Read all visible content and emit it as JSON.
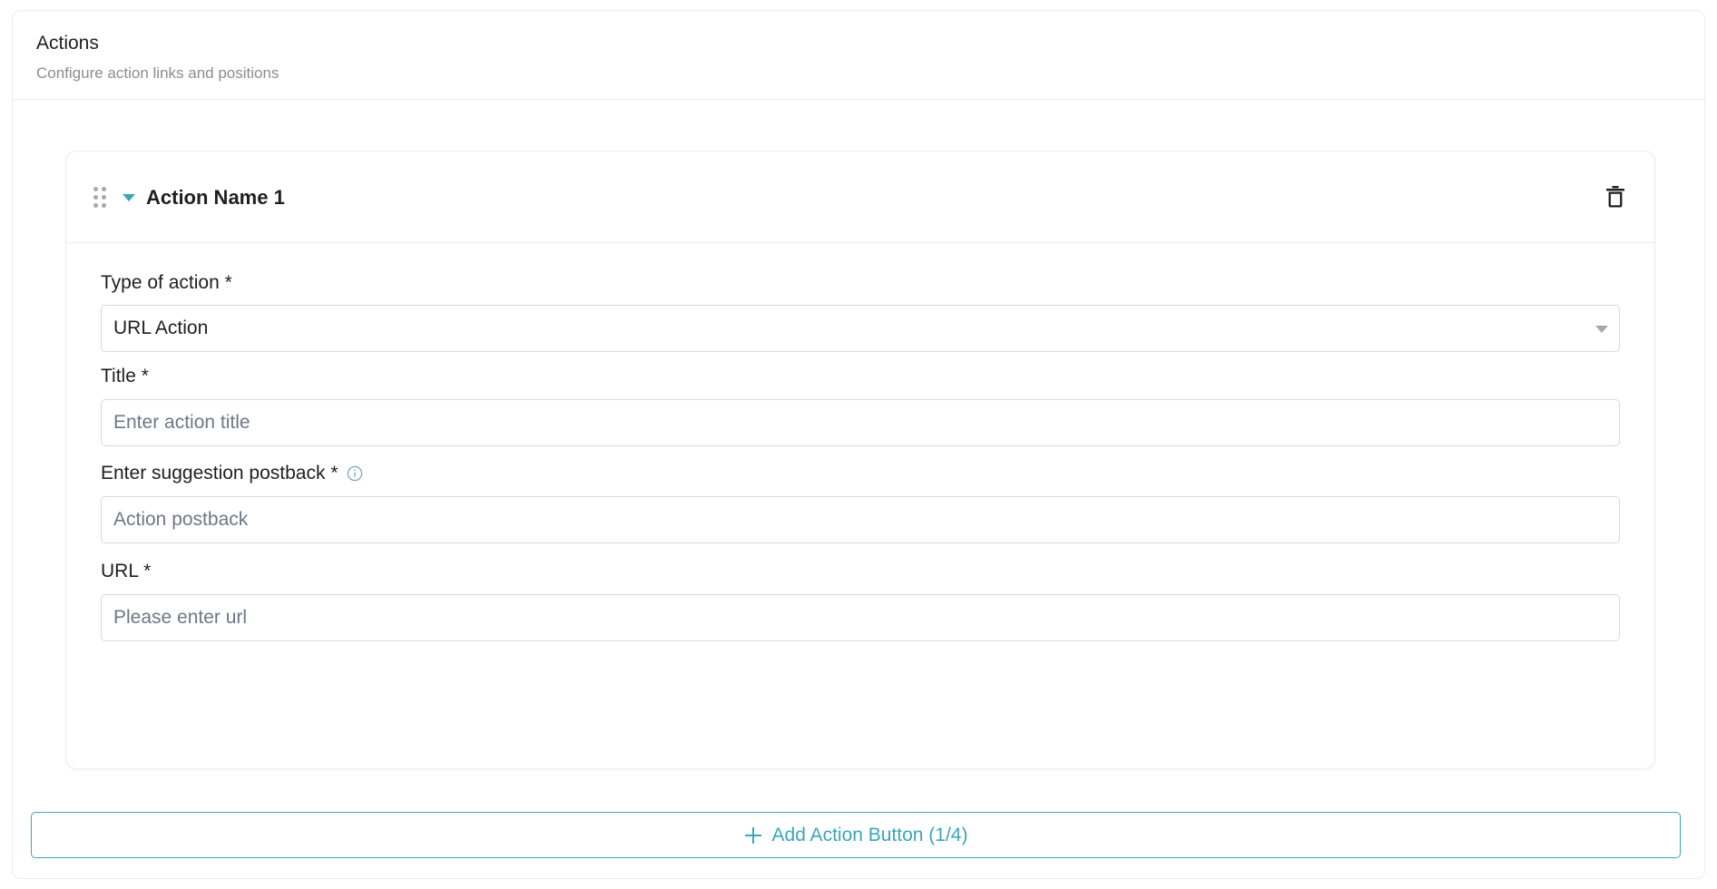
{
  "panel": {
    "title": "Actions",
    "subtitle": "Configure action links and positions"
  },
  "action": {
    "name": "Action Name 1",
    "fields": {
      "type": {
        "label": "Type of action *",
        "value": "URL Action"
      },
      "title": {
        "label": "Title *",
        "placeholder": "Enter action title",
        "value": ""
      },
      "postback": {
        "label": "Enter suggestion postback *",
        "placeholder": "Action postback",
        "value": ""
      },
      "url": {
        "label": "URL *",
        "placeholder": "Please enter url",
        "value": ""
      }
    }
  },
  "add_button": {
    "label": "Add Action Button (1/4)"
  },
  "colors": {
    "accent": "#3aa6b9",
    "border": "#d9d9dc",
    "muted": "#8c8c8c"
  },
  "icons": {
    "drag": "drag-handle-icon",
    "collapse": "caret-down-icon",
    "delete": "trash-icon",
    "info": "info-icon",
    "add": "plus-icon"
  }
}
